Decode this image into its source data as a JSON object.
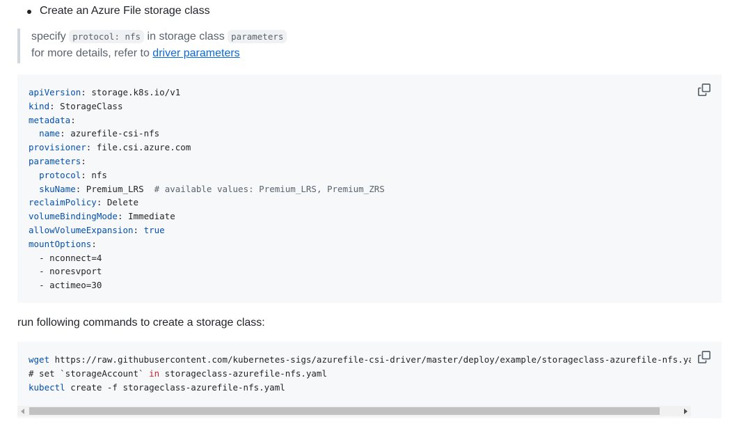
{
  "bullet": {
    "text": "Create an Azure File storage class"
  },
  "quote": {
    "prefix": "specify ",
    "code1": "protocol: nfs",
    "middle": " in storage class ",
    "code2": "parameters",
    "line2_prefix": "for more details, refer to ",
    "link": "driver parameters"
  },
  "yaml_block": {
    "lines": [
      {
        "key": "apiVersion",
        "value": " storage.k8s.io/v1"
      },
      {
        "key": "kind",
        "value": " StorageClass"
      },
      {
        "key": "metadata",
        "value": ""
      },
      {
        "indent": "  ",
        "key": "name",
        "value": " azurefile-csi-nfs"
      },
      {
        "key": "provisioner",
        "value": " file.csi.azure.com"
      },
      {
        "key": "parameters",
        "value": ""
      },
      {
        "indent": "  ",
        "key": "protocol",
        "value": " nfs"
      },
      {
        "indent": "  ",
        "key": "skuName",
        "value": " Premium_LRS",
        "comment": "  # available values: Premium_LRS, Premium_ZRS"
      },
      {
        "key": "reclaimPolicy",
        "value": " Delete"
      },
      {
        "key": "volumeBindingMode",
        "value": " Immediate"
      },
      {
        "key": "allowVolumeExpansion",
        "value": " true",
        "value_kw": true
      },
      {
        "key": "mountOptions",
        "value": ""
      },
      {
        "indent": "  ",
        "item": "- nconnect=4"
      },
      {
        "indent": "  ",
        "item": "- noresvport"
      },
      {
        "indent": "  ",
        "item": "- actimeo=30"
      }
    ]
  },
  "instructions": {
    "text": "run following commands to create a storage class:"
  },
  "shell_block": {
    "line1_cmd": "wget",
    "line1_arg": " https://raw.githubusercontent.com/kubernetes-sigs/azurefile-csi-driver/master/deploy/example/storageclass-azurefile-nfs.yaml",
    "line2_hash": "# set ",
    "line2_code": "`storageAccount`",
    "line2_in": " in",
    "line2_rest": " storageclass-azurefile-nfs.yaml",
    "line3_cmd": "kubectl",
    "line3_rest": " create -f storageclass-azurefile-nfs.yaml"
  },
  "icons": {
    "copy": "copy-icon",
    "scroll_left": "triangle-left-icon",
    "scroll_right": "triangle-right-icon"
  }
}
